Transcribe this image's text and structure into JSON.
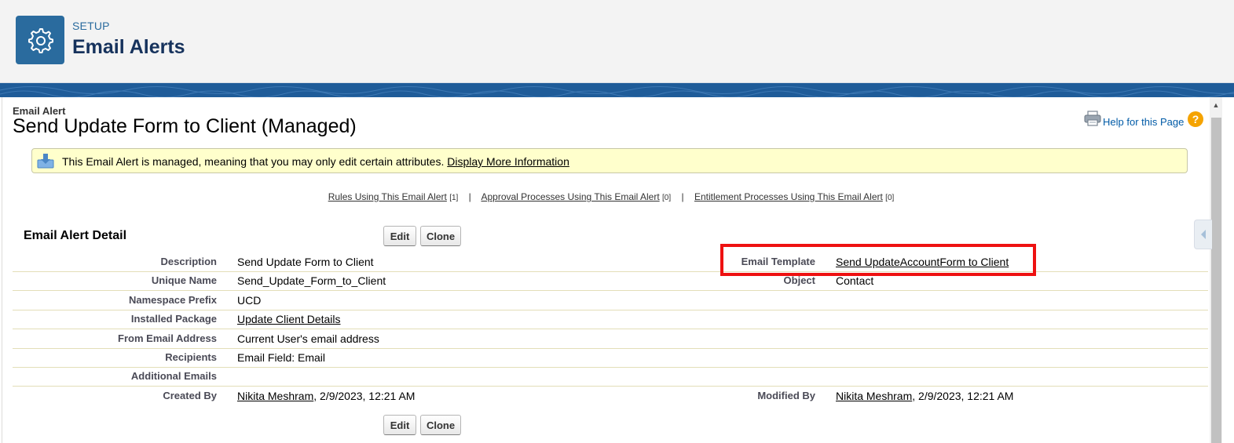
{
  "header": {
    "eyebrow": "SETUP",
    "title": "Email Alerts",
    "icon": "gear-icon"
  },
  "page": {
    "type_label": "Email Alert",
    "name": "Send Update Form to Client (Managed)",
    "help_link": "Help for this Page"
  },
  "info_box": {
    "message": "This Email Alert is managed, meaning that you may only edit certain attributes.",
    "link": "Display More Information"
  },
  "related_links": [
    {
      "label": "Rules Using This Email Alert",
      "count": "[1]"
    },
    {
      "label": "Approval Processes Using This Email Alert",
      "count": "[0]"
    },
    {
      "label": "Entitlement Processes Using This Email Alert",
      "count": "[0]"
    }
  ],
  "separator": "|",
  "detail": {
    "title": "Email Alert Detail",
    "edit_label": "Edit",
    "clone_label": "Clone",
    "fields_left": [
      {
        "label": "Description",
        "value": "Send Update Form to Client"
      },
      {
        "label": "Unique Name",
        "value": "Send_Update_Form_to_Client"
      },
      {
        "label": "Namespace Prefix",
        "value": "UCD"
      },
      {
        "label": "Installed Package",
        "value": "Update Client Details"
      },
      {
        "label": "From Email Address",
        "value": "Current User's email address"
      },
      {
        "label": "Recipients",
        "value": "Email Field: Email"
      },
      {
        "label": "Additional Emails",
        "value": ""
      },
      {
        "label": "Created By",
        "value": "Nikita Meshram",
        "suffix": ", 2/9/2023, 12:21 AM"
      }
    ],
    "fields_right": [
      {
        "label": "Email Template",
        "value": "Send UpdateAccountForm to Client"
      },
      {
        "label": "Object",
        "value": "Contact"
      },
      {
        "label": "Modified By",
        "value": "Nikita Meshram",
        "suffix": ", 2/9/2023, 12:21 AM"
      }
    ]
  },
  "colors": {
    "brand": "#2a6b9e",
    "band": "#1f5c99",
    "highlight": "#ee1111",
    "info_bg": "#ffffcc"
  }
}
